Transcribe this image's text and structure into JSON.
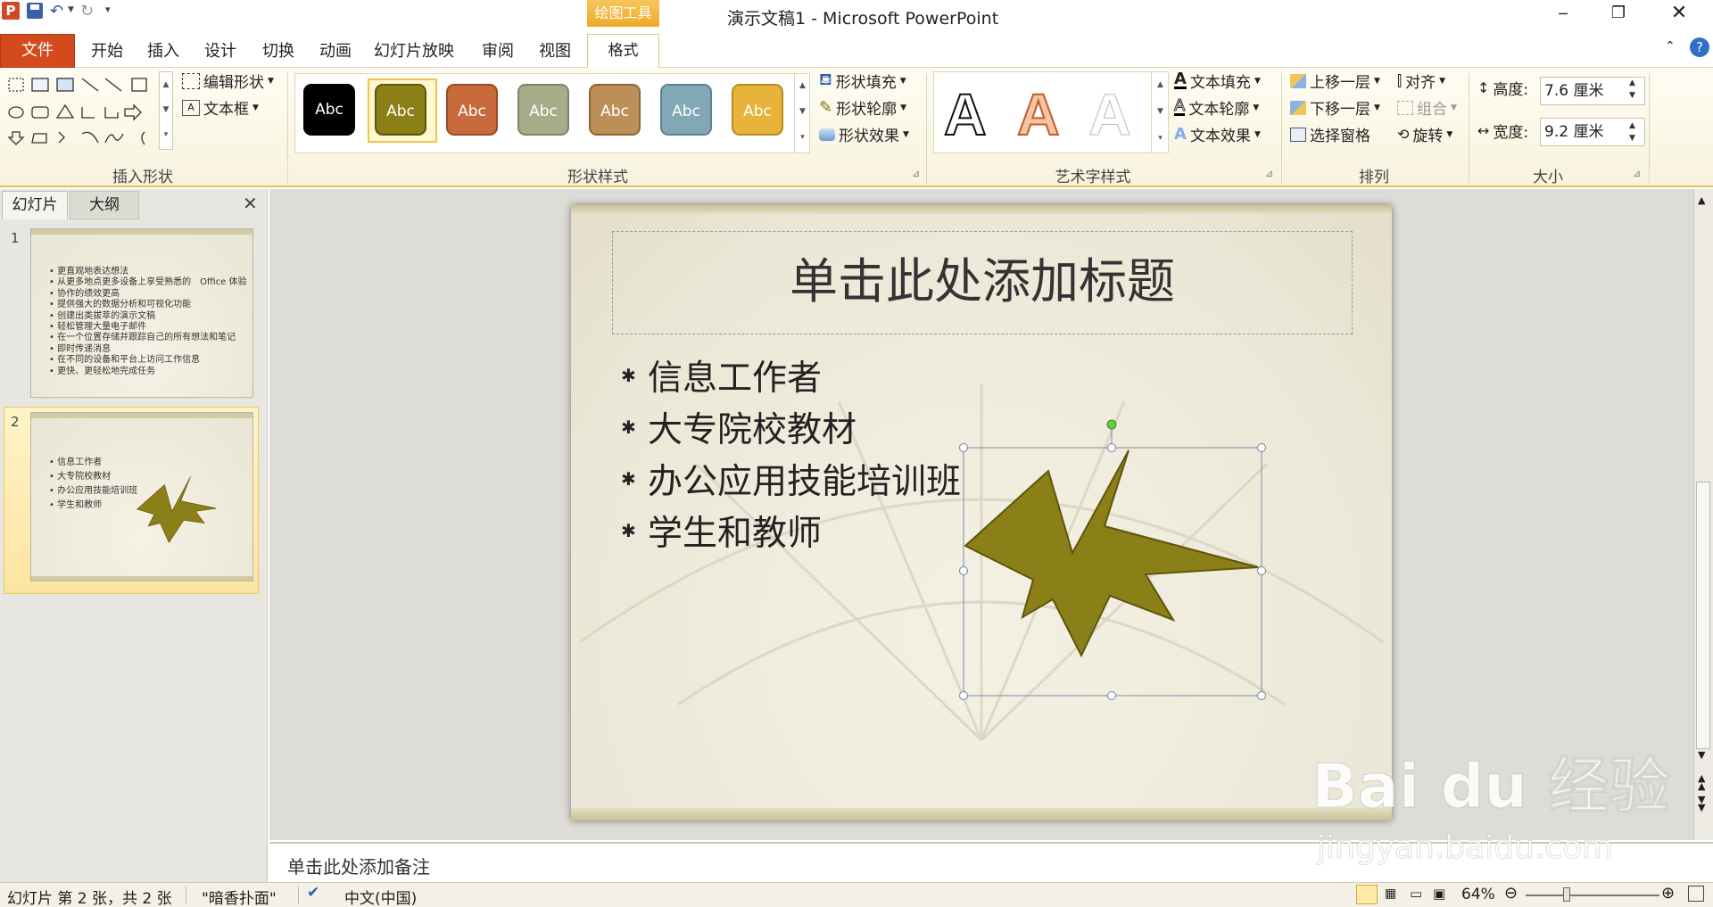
{
  "window": {
    "title": "演示文稿1 - Microsoft PowerPoint",
    "contextual_tab": "绘图工具"
  },
  "qat": {
    "save": "save-icon",
    "undo": "undo-icon",
    "redo": "redo-icon"
  },
  "tabs": [
    "开始",
    "插入",
    "设计",
    "切换",
    "动画",
    "幻灯片放映",
    "审阅",
    "视图"
  ],
  "file_tab": "文件",
  "format_tab": "格式",
  "ribbon": {
    "insert_shapes": {
      "label": "插入形状",
      "edit_shape": "编辑形状",
      "text_box": "文本框"
    },
    "shape_styles": {
      "label": "形状样式",
      "swatch_text": "Abc",
      "swatches": [
        "#000000",
        "#8b7f17",
        "#c86a3c",
        "#a7ad8a",
        "#bd8f58",
        "#82a8b6",
        "#e8b33b"
      ],
      "fill": "形状填充",
      "outline": "形状轮廓",
      "effects": "形状效果"
    },
    "wordart_styles": {
      "label": "艺术字样式",
      "sample": "A",
      "text_fill": "文本填充",
      "text_outline": "文本轮廓",
      "text_effects": "文本效果"
    },
    "arrange": {
      "label": "排列",
      "bring_forward": "上移一层",
      "send_backward": "下移一层",
      "selection_pane": "选择窗格",
      "align": "对齐",
      "group": "组合",
      "rotate": "旋转"
    },
    "size": {
      "label": "大小",
      "height_label": "高度:",
      "height_value": "7.6 厘米",
      "width_label": "宽度:",
      "width_value": "9.2 厘米"
    }
  },
  "panel_tabs": {
    "slides": "幻灯片",
    "outline": "大纲"
  },
  "thumbnails": [
    {
      "number": "1",
      "bullets": [
        "更直观地表达想法",
        "从更多地点更多设备上享受熟悉的　Office 体验",
        "协作的绩效更高",
        "提供强大的数据分析和可视化功能",
        "创建出类拔萃的演示文稿",
        "轻松管理大量电子邮件",
        "在一个位置存储并跟踪自己的所有想法和笔记",
        "即时传递消息",
        "在不同的设备和平台上访问工作信息",
        "更快、更轻松地完成任务"
      ]
    },
    {
      "number": "2",
      "bullets": [
        "信息工作者",
        "大专院校教材",
        "办公应用技能培训班",
        "学生和教师"
      ]
    }
  ],
  "slide": {
    "title": "单击此处添加标题",
    "bullets": [
      "信息工作者",
      "大专院校教材",
      "办公应用技能培训班",
      "学生和教师"
    ],
    "shape_color": "#8b7f17"
  },
  "notes_placeholder": "单击此处添加备注",
  "status": {
    "slide_info": "幻灯片 第 2 张，共 2 张",
    "theme": "\"暗香扑面\"",
    "language": "中文(中国)",
    "zoom": "64%"
  },
  "watermark": {
    "logo": "Bai du 经验",
    "url": "jingyan.baidu.com"
  }
}
